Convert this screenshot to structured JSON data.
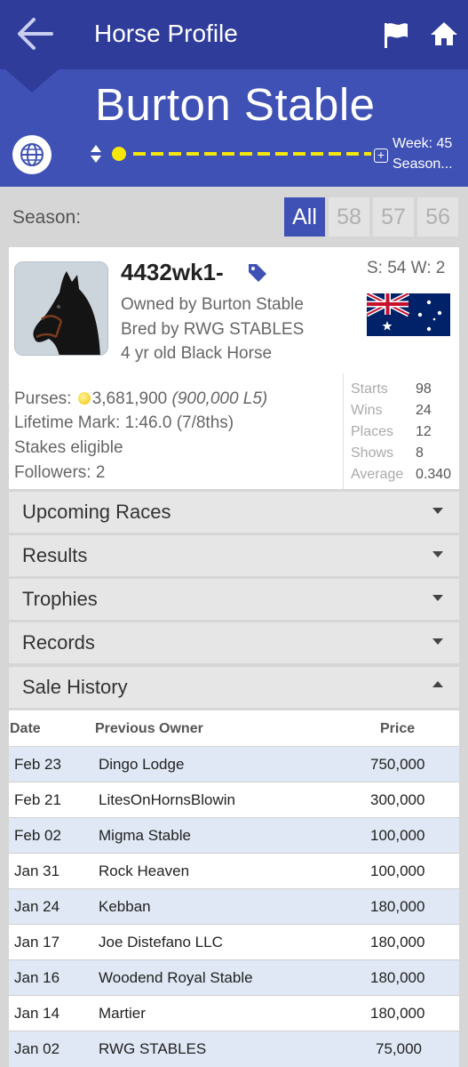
{
  "header": {
    "title": "Horse Profile"
  },
  "stable": {
    "name": "Burton Stable",
    "week": "Week: 45",
    "season": "Season..."
  },
  "seasons": {
    "label": "Season:",
    "tabs": [
      "All",
      "58",
      "57",
      "56"
    ],
    "active": "All"
  },
  "horse": {
    "name": "4432wk1-",
    "starts_wins": "S: 54 W: 2",
    "owned_by": "Owned by Burton Stable",
    "bred_by": "Bred by RWG STABLES",
    "description": "4 yr old Black Horse",
    "purses_label": "Purses:",
    "purses_value": "3,681,900",
    "purses_l5": "(900,000 L5)",
    "lifetime_mark": "Lifetime Mark: 1:46.0 (7/8ths)",
    "stakes": "Stakes eligible",
    "followers": "Followers: 2",
    "country_flag": "australia-flag"
  },
  "stats": [
    {
      "label": "Starts",
      "value": "98"
    },
    {
      "label": "Wins",
      "value": "24"
    },
    {
      "label": "Places",
      "value": "12"
    },
    {
      "label": "Shows",
      "value": "8"
    },
    {
      "label": "Average",
      "value": "0.340"
    }
  ],
  "sections": {
    "upcoming": "Upcoming Races",
    "results": "Results",
    "trophies": "Trophies",
    "records": "Records",
    "sale_history": "Sale History"
  },
  "sale_history": {
    "columns": [
      "Date",
      "Previous Owner",
      "Price"
    ],
    "rows": [
      {
        "date": "Feb 23",
        "owner": "Dingo Lodge",
        "price": "750,000"
      },
      {
        "date": "Feb 21",
        "owner": "LitesOnHornsBlowin",
        "price": "300,000"
      },
      {
        "date": "Feb 02",
        "owner": "Migma Stable",
        "price": "100,000"
      },
      {
        "date": "Jan 31",
        "owner": "Rock Heaven",
        "price": "100,000"
      },
      {
        "date": "Jan 24",
        "owner": "Kebban",
        "price": "180,000"
      },
      {
        "date": "Jan 17",
        "owner": "Joe Distefano LLC",
        "price": "180,000"
      },
      {
        "date": "Jan 16",
        "owner": "Woodend Royal Stable",
        "price": "180,000"
      },
      {
        "date": "Jan 14",
        "owner": "Martier",
        "price": "180,000"
      },
      {
        "date": "Jan 02",
        "owner": "RWG STABLES",
        "price": "75,000"
      }
    ]
  },
  "colors": {
    "appbar": "#2f3c9a",
    "stablebar": "#3f51b5",
    "accent_yellow": "#f5e70a",
    "row_alt": "#dfe8f4"
  }
}
